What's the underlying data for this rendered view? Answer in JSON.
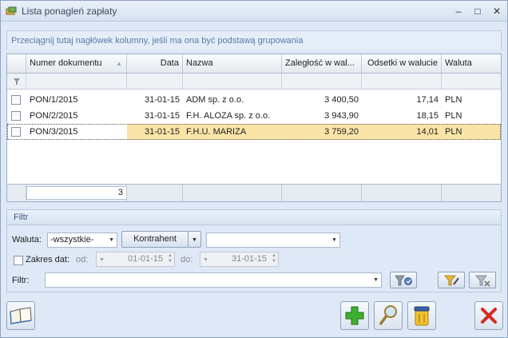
{
  "window": {
    "title": "Lista ponagleń zapłaty",
    "minimize": "–",
    "maximize": "□",
    "close": "✕"
  },
  "group_hint": "Przeciągnij tutaj nagłówek kolumny, jeśli ma ona być podstawą grupowania",
  "grid": {
    "columns": [
      "Numer dokumentu",
      "Data",
      "Nazwa",
      "Zaległość w wal...",
      "Odsetki w walucie",
      "Waluta"
    ],
    "rows": [
      {
        "numer": "PON/1/2015",
        "data": "31-01-15",
        "nazwa": "ADM sp. z o.o.",
        "zaleglosc": "3 400,50",
        "odsetki": "17,14",
        "waluta": "PLN"
      },
      {
        "numer": "PON/2/2015",
        "data": "31-01-15",
        "nazwa": "F.H. ALOZA sp. z o.o.",
        "zaleglosc": "3 943,90",
        "odsetki": "18,15",
        "waluta": "PLN"
      },
      {
        "numer": "PON/3/2015",
        "data": "31-01-15",
        "nazwa": "F.H.U. MARIZA",
        "zaleglosc": "3 759,20",
        "odsetki": "14,01",
        "waluta": "PLN"
      }
    ],
    "count": "3",
    "selected_row": 2,
    "highlight_color": "#fbe4a8"
  },
  "filter": {
    "title": "Filtr",
    "waluta_label": "Waluta:",
    "waluta_value": "-wszystkie-",
    "kontrahent_button": "Kontrahent",
    "kontrahent_value": "",
    "zakres_label": "Zakres dat:",
    "od_label": "od:",
    "od_value": "01-01-15",
    "do_label": "do:",
    "do_value": "31-01-15",
    "filtr_label": "Filtr:",
    "filtr_value": ""
  },
  "icons": {
    "app": "app-icon",
    "filter_apply": "funnel-icon",
    "filter_clear": "funnel-clear-icon",
    "filter_edit": "funnel-edit-icon",
    "filter_remove": "funnel-remove-icon",
    "book": "book-icon",
    "add": "plus-icon",
    "edit": "magnifier-icon",
    "delete": "trash-icon",
    "cancel": "close-x-icon"
  }
}
